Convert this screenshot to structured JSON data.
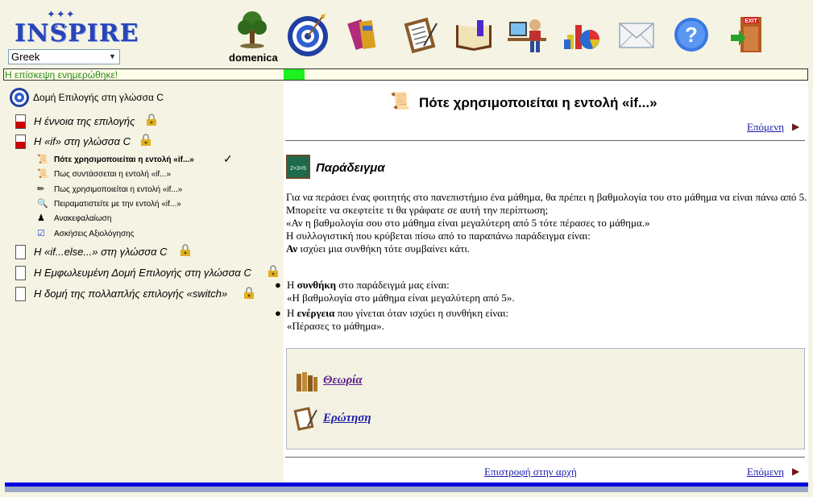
{
  "header": {
    "logo": "INSPIRE",
    "language": "Greek",
    "username": "domenica",
    "tools": [
      "tree-icon",
      "target-icon",
      "books-icon",
      "clipboard-icon",
      "open-book-icon",
      "student-icon",
      "chart-icon",
      "mail-icon",
      "help-icon",
      "exit-icon"
    ],
    "exit_sign": "EXIT"
  },
  "status": {
    "message": "Η επίσκεψη ενημερώθηκε!",
    "progress": 0.03
  },
  "sidebar": {
    "root": "Δομή Επιλογής στη γλώσσα C",
    "items": [
      {
        "label": "Η έννοια της επιλογής",
        "icon": "page-red-icon"
      },
      {
        "label": "Η «if» στη γλώσσα C",
        "icon": "page-red-icon"
      },
      {
        "label": "Η «if...else...» στη γλώσσα C",
        "icon": "page-empty-icon"
      },
      {
        "label": "Η Εμφωλευμένη Δομή Επιλογής στη γλώσσα C",
        "icon": "page-empty-icon"
      },
      {
        "label": "Η δομή της πολλαπλής επιλογής «switch»",
        "icon": "page-empty-icon"
      }
    ],
    "subitems": [
      "Πότε χρησιμοποιείται η εντολή «if...»",
      "Πως συντάσσεται η εντολή «if...»",
      "Πως χρησιμοποιείται η εντολή «if...»",
      "Πειραματιστείτε με την εντολή «if...»",
      "Ανακεφαλαίωση",
      "Ασκήσεις Αξιολόγησης"
    ],
    "check": "✓"
  },
  "content": {
    "title": "Πότε χρησιμοποιείται η εντολή «if...»",
    "next": "Επόμενη",
    "section_title": "Παράδειγμα",
    "chalk_text": "2+3=5",
    "para1": "Για να περάσει ένας φοιτητής στο πανεπιστήμιο ένα μάθημα, θα πρέπει η βαθμολογία του στο μάθημα να είναι πάνω από 5. Μπορείτε να σκεφτείτε τι θα γράφατε σε αυτή την περίπτωση;",
    "para2": "«Αν η βαθμολογία σου στο μάθημα είναι μεγαλύτερη από 5 τότε πέρασες το μάθημα.»",
    "para3": "Η συλλογιστική που κρύβεται πίσω από το παραπάνω παράδειγμα είναι:",
    "para4_bold": "Αν",
    "para4_rest": " ισχύει μια συνθήκη τότε συμβαίνει κάτι.",
    "bullet1_pre": "Η ",
    "bullet1_bold": "συνθήκη",
    "bullet1_post": " στο παράδειγμά μας είναι:",
    "bullet1_line2": "«Η βαθμολογία στο μάθημα είναι μεγαλύτερη από 5».",
    "bullet2_pre": "Η ",
    "bullet2_bold": "ενέργεια",
    "bullet2_post": " που γίνεται όταν ισχύει η συνθήκη είναι:",
    "bullet2_line2": "«Πέρασες το μάθημα».",
    "link_theory": "Θεωρία",
    "link_question": "Ερώτηση",
    "back_to_start": "Επιστροφή στην αρχή",
    "next_bottom": "Επόμενη"
  }
}
